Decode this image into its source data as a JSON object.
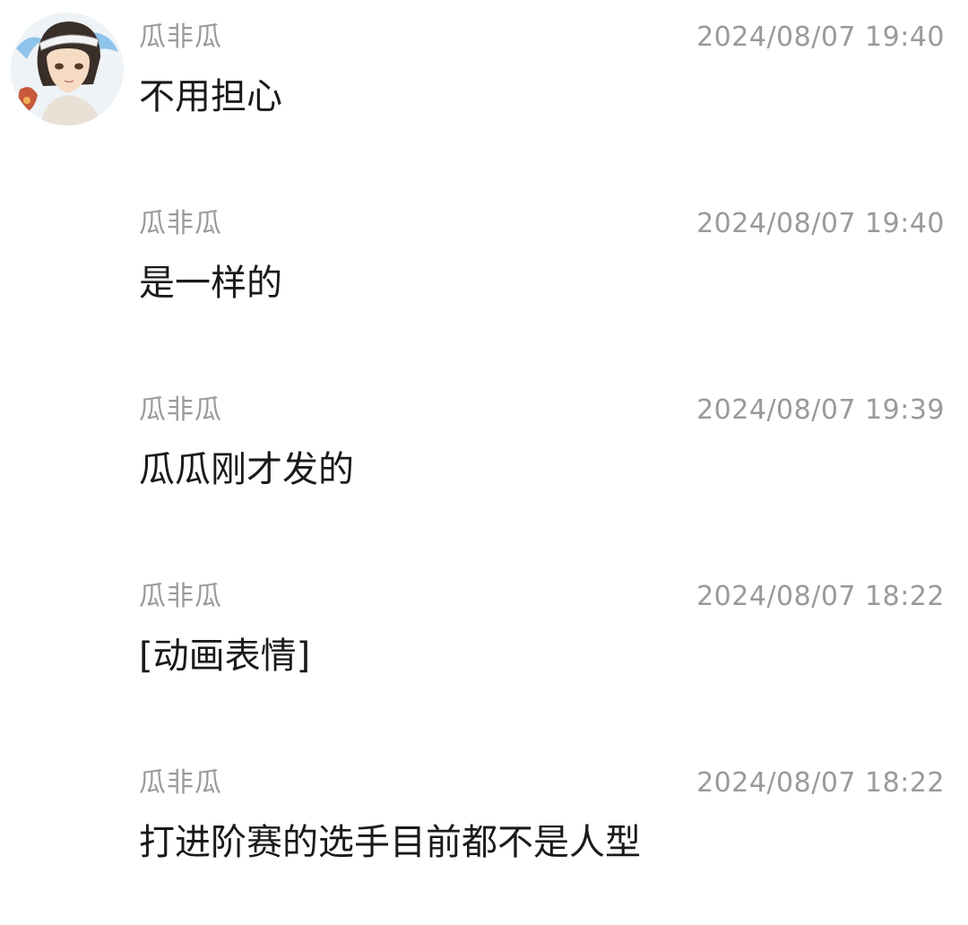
{
  "messages": [
    {
      "sender": "瓜非瓜",
      "time": "2024/08/07 19:40",
      "text": "不用担心",
      "has_avatar": true
    },
    {
      "sender": "瓜非瓜",
      "time": "2024/08/07 19:40",
      "text": "是一样的",
      "has_avatar": false
    },
    {
      "sender": "瓜非瓜",
      "time": "2024/08/07 19:39",
      "text": "瓜瓜刚才发的",
      "has_avatar": false
    },
    {
      "sender": "瓜非瓜",
      "time": "2024/08/07 18:22",
      "text": "[动画表情]",
      "has_avatar": false
    },
    {
      "sender": "瓜非瓜",
      "time": "2024/08/07 18:22",
      "text": "打进阶赛的选手目前都不是人型",
      "has_avatar": false
    }
  ]
}
